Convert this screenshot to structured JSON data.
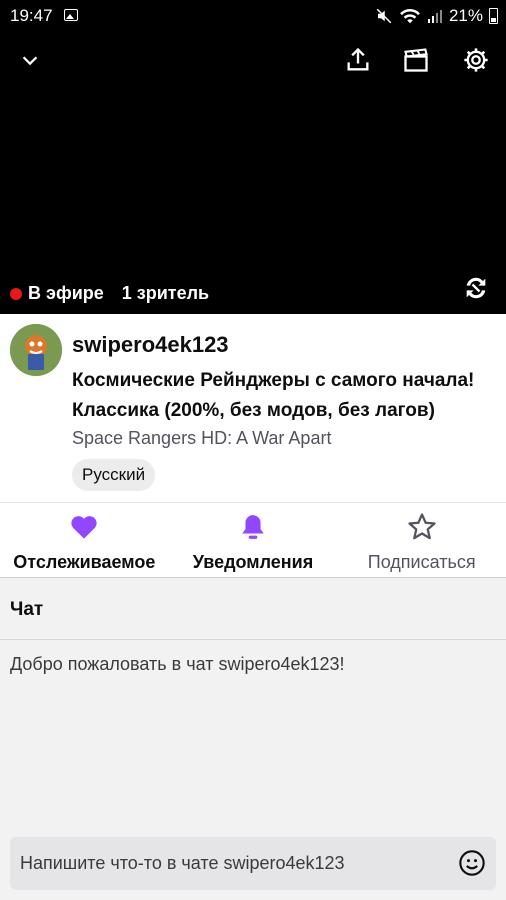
{
  "status_bar": {
    "time": "19:47",
    "battery_pct": "21%"
  },
  "player": {
    "live_label": "В эфире",
    "viewers": "1 зритель"
  },
  "channel": {
    "name": "swipero4ek123",
    "title": "Космические Рейнджеры с самого начала! Классика (200%, без модов, без лагов)",
    "game": "Space Rangers HD: A War Apart",
    "tag": "Русский"
  },
  "actions": {
    "follow_label": "Отслеживаемое",
    "notify_label": "Уведомления",
    "subscribe_label": "Подписаться"
  },
  "chat": {
    "title": "Чат",
    "welcome": "Добро пожаловать в чат swipero4ek123!",
    "input_placeholder": "Напишите что-то в чате swipero4ek123"
  },
  "colors": {
    "accent": "#9147ff",
    "live": "#e91916"
  },
  "icons": [
    "chevron-down-icon",
    "share-icon",
    "clip-icon",
    "settings-icon",
    "rotate-icon",
    "heart-icon",
    "bell-icon",
    "star-icon",
    "emoji-icon"
  ]
}
